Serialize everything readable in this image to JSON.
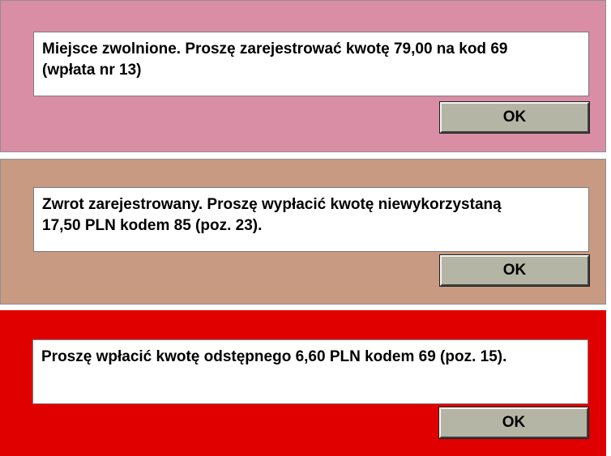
{
  "dialogs": [
    {
      "background": "#d98ea5",
      "message_lines": [
        "Miejsce zwolnione. Proszę zarejestrować kwotę 79,00 na kod 69",
        "(wpłata nr 13)"
      ],
      "ok_label": "OK"
    },
    {
      "background": "#c89a82",
      "message_lines": [
        "Zwrot zarejestrowany. Proszę wypłacić kwotę niewykorzystaną",
        "17,50 PLN kodem 85 (poz. 23)."
      ],
      "ok_label": "OK"
    },
    {
      "background": "#e00000",
      "message_lines": [
        "Proszę wpłacić kwotę odstępnego 6,60 PLN kodem 69 (poz. 15)."
      ],
      "ok_label": "OK"
    }
  ],
  "colors": {
    "button_face": "#b5b5a6",
    "message_background": "#ffffff"
  }
}
